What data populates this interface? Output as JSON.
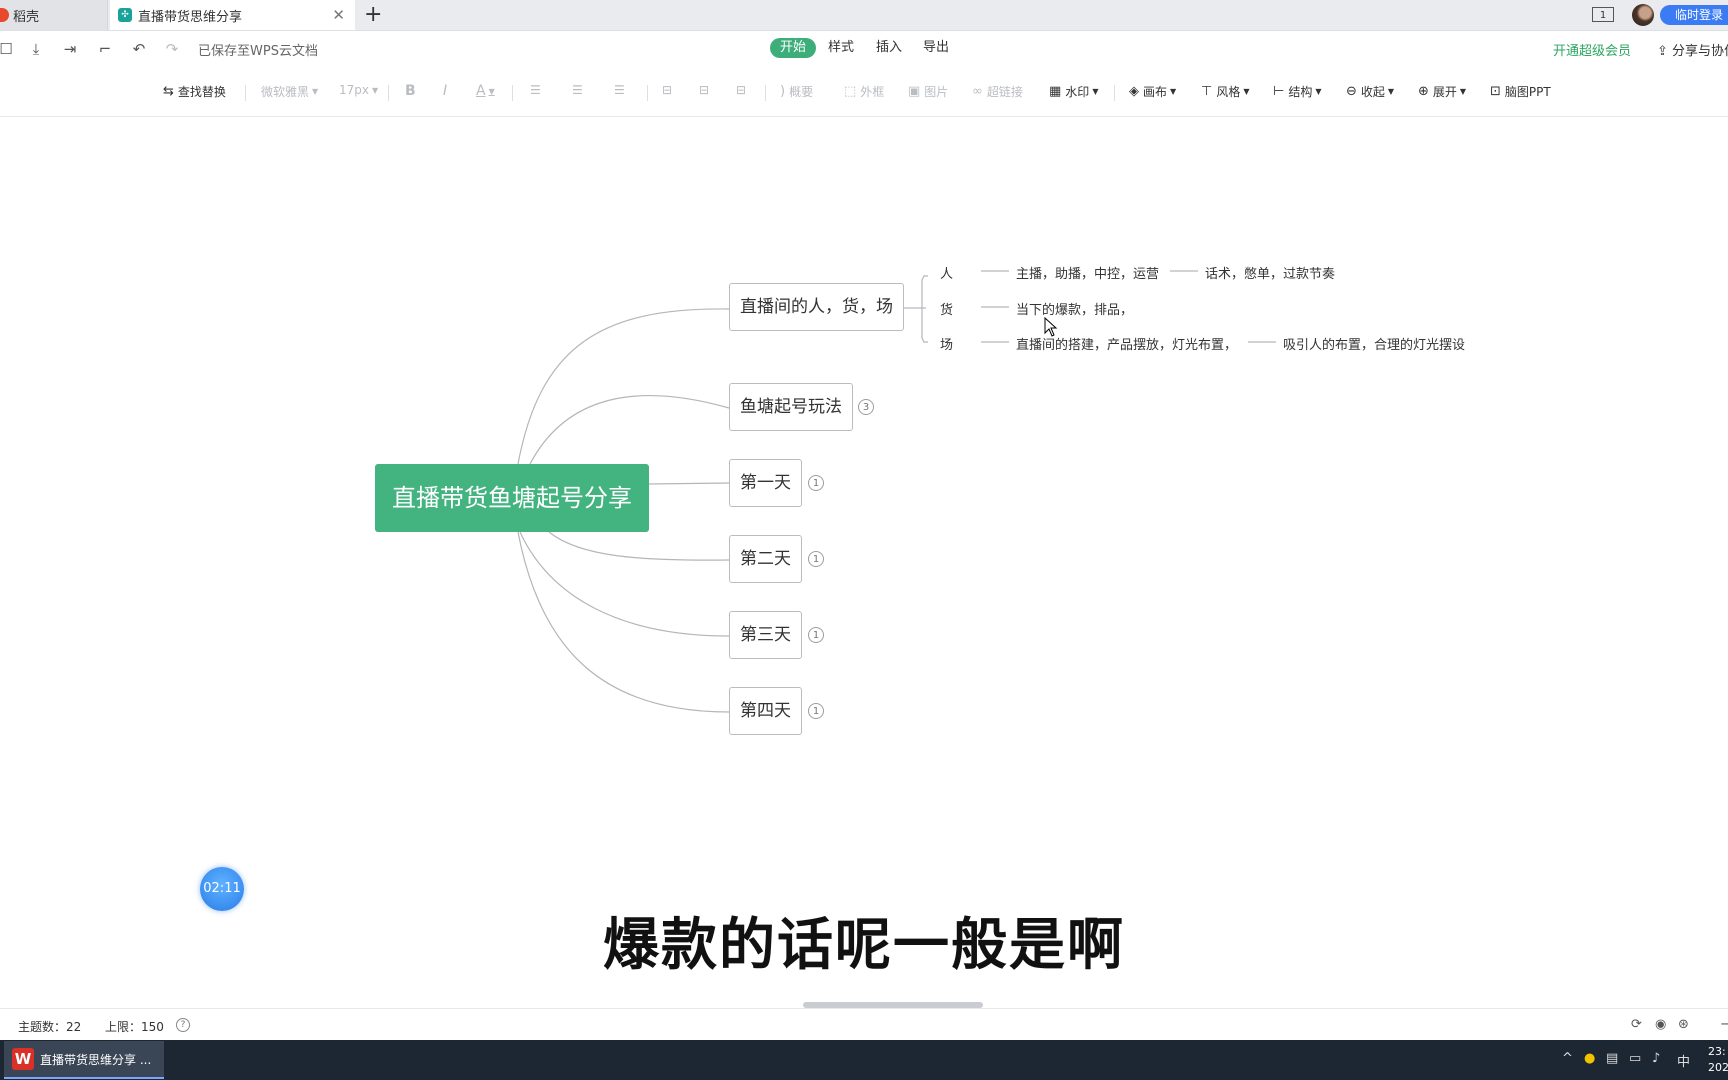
{
  "tabs": {
    "inactive_label": "稻壳",
    "active_label": "直播带货思维分享",
    "close": "✕",
    "add": "+"
  },
  "topright": {
    "layout_icon": "1",
    "login": "临时登录"
  },
  "menubar": {
    "saved_status": "已保存至WPS云文档",
    "tabs": [
      "开始",
      "样式",
      "插入",
      "导出"
    ],
    "vip": "开通超级会员",
    "share": "分享与协作"
  },
  "toolbar": {
    "find_replace": "查找替换",
    "font": "微软雅黑",
    "font_size": "17px",
    "bold": "B",
    "italic": "I",
    "font_color": "A",
    "summary": "概要",
    "border": "外框",
    "image": "图片",
    "hyperlink": "超链接",
    "watermark": "水印",
    "canvas": "画布",
    "style": "风格",
    "structure": "结构",
    "collapse": "收起",
    "expand": "展开",
    "mind_ppt": "脑图PPT"
  },
  "mindmap": {
    "root": "直播带货鱼塘起号分享",
    "branches": [
      {
        "label": "直播间的人，货，场",
        "badge": ""
      },
      {
        "label": "鱼塘起号玩法",
        "badge": "3"
      },
      {
        "label": "第一天",
        "badge": "1"
      },
      {
        "label": "第二天",
        "badge": "1"
      },
      {
        "label": "第三天",
        "badge": "1"
      },
      {
        "label": "第四天",
        "badge": "1"
      }
    ],
    "sub": {
      "person": "人",
      "person_detail": "主播，助播，中控，运营",
      "person_detail2": "话术，憋单，过款节奏",
      "goods": "货",
      "goods_detail": "当下的爆款，排品，",
      "venue": "场",
      "venue_detail": "直播间的搭建，产品摆放，灯光布置，",
      "venue_detail2": "吸引人的布置，合理的灯光摆设"
    }
  },
  "overlay": {
    "timer": "02:11",
    "subtitle": "爆款的话呢一般是啊"
  },
  "statusbar": {
    "topic_count": "主题数：22",
    "limit": "上限：150",
    "help": "?"
  },
  "taskbar": {
    "app_label": "直播带货思维分享 ...",
    "ime": "中",
    "time": "23:",
    "date": "202"
  }
}
